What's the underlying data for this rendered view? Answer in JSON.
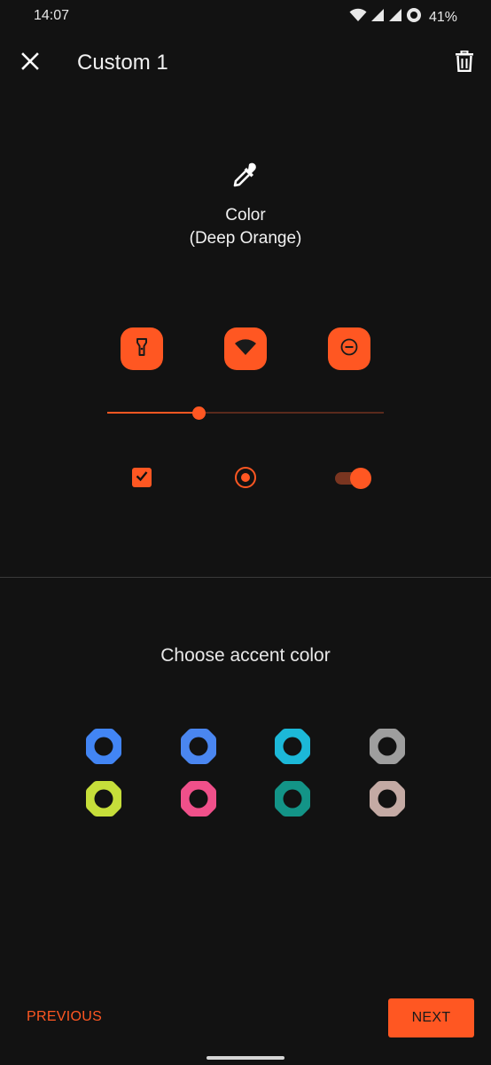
{
  "status_bar": {
    "time": "14:07",
    "battery": "41%",
    "icons": [
      "wifi-icon",
      "signal-icon",
      "signal-icon",
      "record-icon"
    ]
  },
  "app_bar": {
    "title": "Custom 1",
    "close_icon": "close-icon",
    "delete_icon": "trash-icon"
  },
  "preview": {
    "picker_icon": "eyedropper-icon",
    "label": "Color",
    "color_name": "(Deep Orange)",
    "tiles": [
      "flashlight-icon",
      "wifi-icon",
      "do-not-disturb-icon"
    ],
    "slider_value": 0.33,
    "checkbox_checked": true,
    "radio_selected": true,
    "switch_on": true
  },
  "accent": {
    "label": "Choose accent color",
    "swatches": [
      {
        "name": "blue",
        "color": "#4285f4"
      },
      {
        "name": "blue-2",
        "color": "#4a86f0"
      },
      {
        "name": "cyan",
        "color": "#1cb8d8"
      },
      {
        "name": "grey",
        "color": "#9e9e9e"
      },
      {
        "name": "lime",
        "color": "#c6de3a"
      },
      {
        "name": "pink",
        "color": "#f0508a"
      },
      {
        "name": "teal",
        "color": "#139487"
      },
      {
        "name": "rose-brown",
        "color": "#c4aaa4"
      }
    ]
  },
  "nav": {
    "previous_label": "PREVIOUS",
    "next_label": "NEXT"
  },
  "colors": {
    "accent": "#ff5722",
    "background": "#121212",
    "slider_track": "#5a2a1c",
    "switch_track": "#7a3520",
    "text": "#ffffff"
  }
}
